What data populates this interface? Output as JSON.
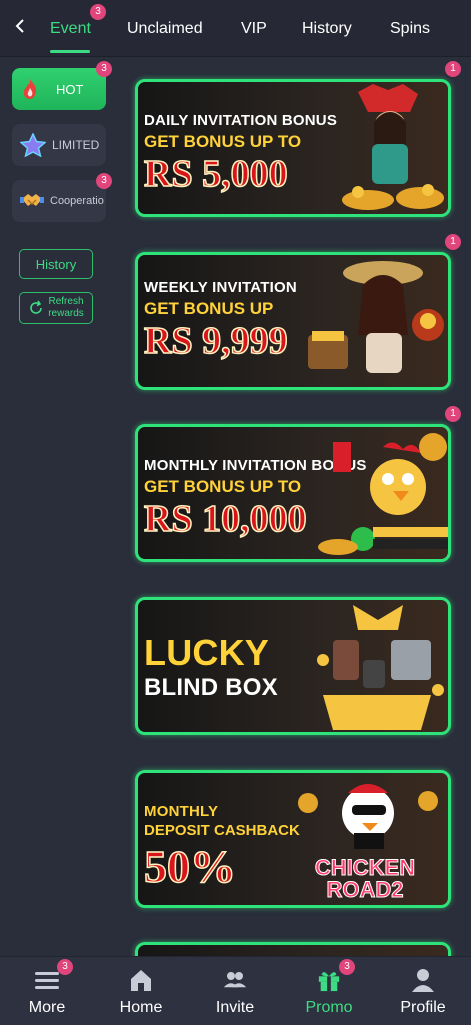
{
  "tabs": [
    {
      "label": "Event",
      "badge": "3"
    },
    {
      "label": "Unclaimed"
    },
    {
      "label": "VIP"
    },
    {
      "label": "History"
    },
    {
      "label": "Spins"
    }
  ],
  "sidebar": {
    "categories": [
      {
        "label": "HOT",
        "badge": "3"
      },
      {
        "label": "LIMITED"
      },
      {
        "label": "Cooperatio",
        "badge": "3"
      }
    ],
    "history_label": "History",
    "refresh_label_1": "Refresh",
    "refresh_label_2": "rewards"
  },
  "banners": [
    {
      "line1": "DAILY INVITATION BONUS",
      "line2": "GET BONUS UP TO",
      "line3": "RS 5,000",
      "badge": "1"
    },
    {
      "line1": "WEEKLY INVITATION",
      "line2": "GET BONUS UP",
      "line3": "RS 9,999",
      "badge": "1"
    },
    {
      "line1": "MONTHLY INVITATION BONUS",
      "line2": "GET BONUS UP TO",
      "line3": "RS 10,000",
      "badge": "1"
    },
    {
      "line1": "LUCKY",
      "line2": "BLIND BOX"
    },
    {
      "line1": "MONTHLY",
      "line2": "DEPOSIT CASHBACK",
      "line3": "50%",
      "logo_text_1": "CHICKEN",
      "logo_text_2": "ROAD2"
    }
  ],
  "bottom_nav": [
    {
      "label": "More",
      "badge": "3",
      "icon": "menu-icon"
    },
    {
      "label": "Home",
      "icon": "home-icon"
    },
    {
      "label": "Invite",
      "icon": "users-icon"
    },
    {
      "label": "Promo",
      "badge": "3",
      "icon": "gift-icon"
    },
    {
      "label": "Profile",
      "icon": "person-icon"
    }
  ],
  "colors": {
    "accent": "#3ddc84",
    "badge": "#e0457b",
    "background": "#2a2d3a"
  }
}
